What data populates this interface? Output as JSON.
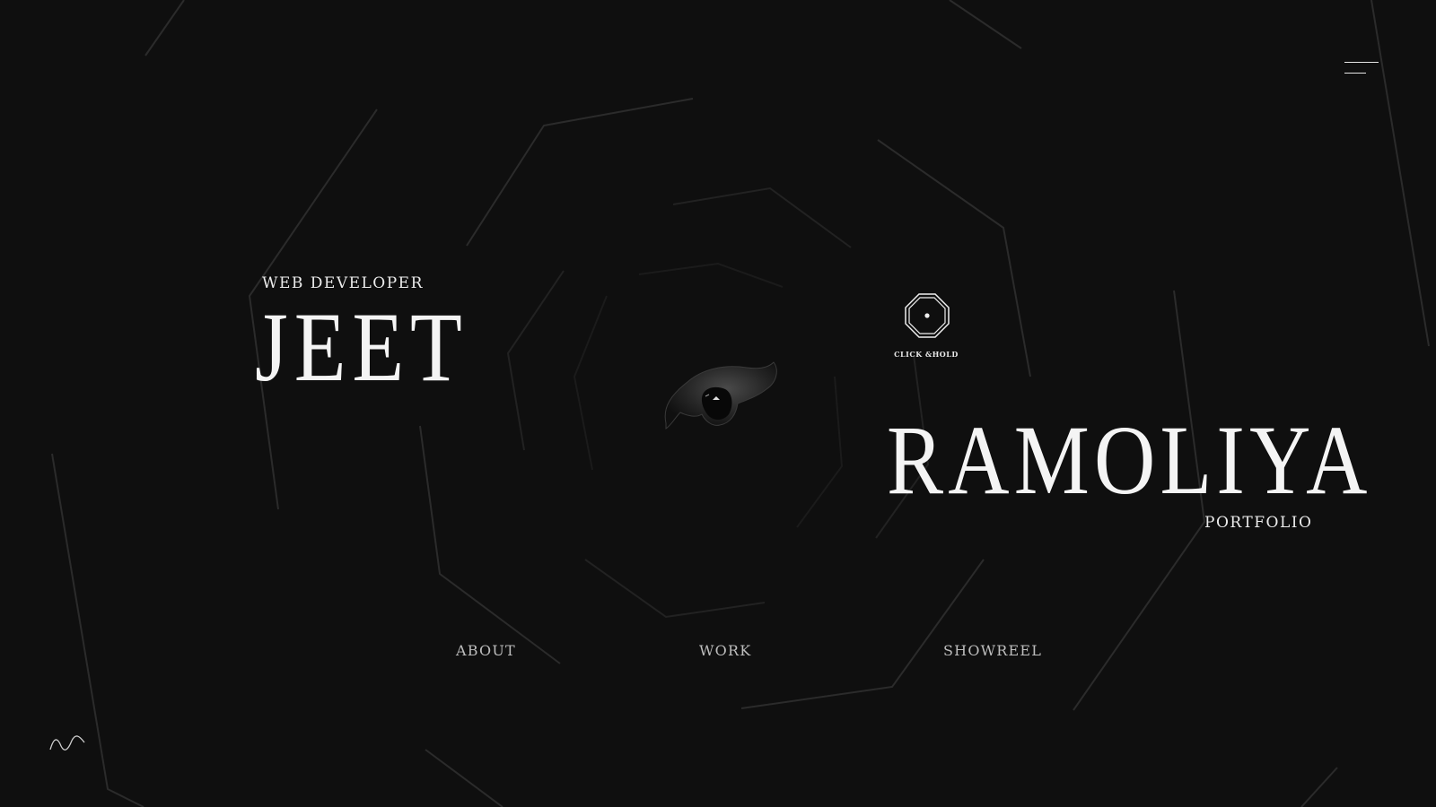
{
  "header": {
    "menu_icon": "hamburger-menu-icon"
  },
  "hero": {
    "subtitle": "WEB DEVELOPER",
    "first_name": "JEET",
    "last_name": "RAMOLIYA",
    "tagline": "PORTFOLIO"
  },
  "interaction": {
    "hold_label": "CLICK &HOLD",
    "hold_icon": "octagon-icon"
  },
  "center_model": {
    "icon": "3d-creature-model"
  },
  "nav": {
    "items": [
      {
        "label": "ABOUT"
      },
      {
        "label": "WORK"
      },
      {
        "label": "SHOWREEL"
      }
    ]
  },
  "footer": {
    "sound_icon": "sound-wave-icon"
  },
  "colors": {
    "background": "#0f0f0f",
    "text_primary": "#f4f4f4",
    "text_nav": "#bdbdbd",
    "lines": "#2a2a2a"
  }
}
